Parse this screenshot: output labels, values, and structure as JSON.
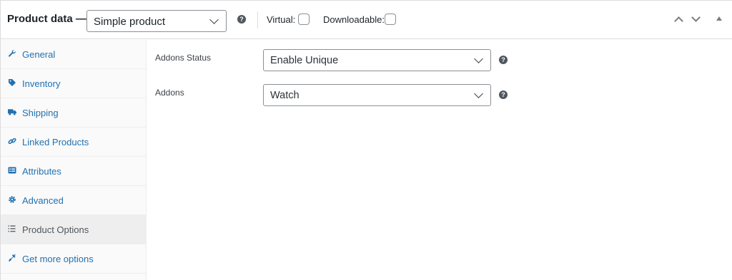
{
  "header": {
    "title": "Product data —",
    "product_type": "Simple product",
    "virtual_label": "Virtual:",
    "downloadable_label": "Downloadable:",
    "help_icon": "?"
  },
  "sidebar": {
    "items": [
      {
        "label": "General",
        "icon": "wrench-icon"
      },
      {
        "label": "Inventory",
        "icon": "tag-icon"
      },
      {
        "label": "Shipping",
        "icon": "truck-icon"
      },
      {
        "label": "Linked Products",
        "icon": "link-icon"
      },
      {
        "label": "Attributes",
        "icon": "list-card-icon"
      },
      {
        "label": "Advanced",
        "icon": "gear-icon"
      },
      {
        "label": "Product Options",
        "icon": "list-icon",
        "active": true
      },
      {
        "label": "Get more options",
        "icon": "plug-icon"
      }
    ]
  },
  "fields": {
    "addons_status": {
      "label": "Addons Status",
      "value": "Enable Unique"
    },
    "addons": {
      "label": "Addons",
      "value": "Watch"
    }
  },
  "colors": {
    "link": "#2271b1",
    "border": "#dcdcde",
    "active_tab_bg": "#eeeeee"
  }
}
